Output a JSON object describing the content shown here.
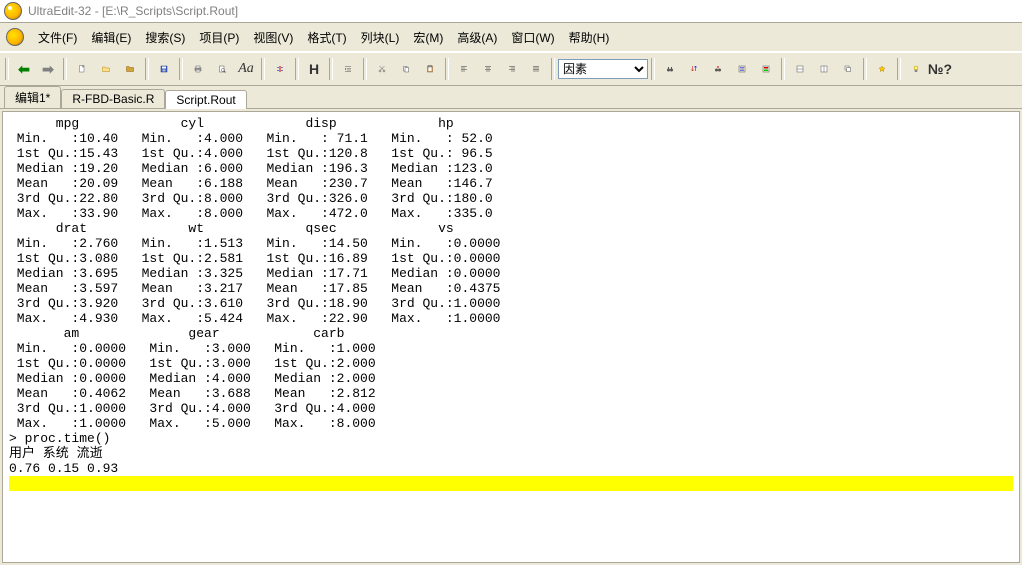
{
  "window": {
    "title": "UltraEdit-32 - [E:\\R_Scripts\\Script.Rout]"
  },
  "menus": {
    "file": "文件(F)",
    "edit": "编辑(E)",
    "search": "搜索(S)",
    "project": "项目(P)",
    "view": "视图(V)",
    "format": "格式(T)",
    "column": "列块(L)",
    "macro": "宏(M)",
    "advanced": "高级(A)",
    "window": "窗口(W)",
    "help": "帮助(H)"
  },
  "combo": {
    "value": "因素"
  },
  "tabs": [
    {
      "label": "编辑1*",
      "active": false
    },
    {
      "label": "R-FBD-Basic.R",
      "active": false
    },
    {
      "label": "Script.Rout",
      "active": true
    }
  ],
  "toolbar_buttons": {
    "back": "back",
    "forward": "forward",
    "new": "new",
    "open": "open",
    "close": "close",
    "save": "save",
    "print": "print",
    "preview": "preview",
    "font": "font",
    "toggle": "toggle",
    "heading": "heading",
    "indent": "indent",
    "cut": "cut",
    "copy": "copy",
    "paste": "paste",
    "align_left": "align-left",
    "align_center": "align-center",
    "align_right": "align-right",
    "align_justify": "align-justify",
    "find": "find",
    "sort_asc": "sort-asc",
    "sort_desc": "sort-desc",
    "tool1": "tool1",
    "tool2": "tool2",
    "split_h": "split-h",
    "split_v": "split-v",
    "cascade": "cascade",
    "tool3": "tool3",
    "tip": "tip",
    "help": "help"
  },
  "output": {
    "header1": "      mpg             cyl             disp             hp       ",
    "block1": [
      " Min.   :10.40   Min.   :4.000   Min.   : 71.1   Min.   : 52.0  ",
      " 1st Qu.:15.43   1st Qu.:4.000   1st Qu.:120.8   1st Qu.: 96.5  ",
      " Median :19.20   Median :6.000   Median :196.3   Median :123.0  ",
      " Mean   :20.09   Mean   :6.188   Mean   :230.7   Mean   :146.7  ",
      " 3rd Qu.:22.80   3rd Qu.:8.000   3rd Qu.:326.0   3rd Qu.:180.0  ",
      " Max.   :33.90   Max.   :8.000   Max.   :472.0   Max.   :335.0  "
    ],
    "header2": "      drat             wt             qsec             vs        ",
    "block2": [
      " Min.   :2.760   Min.   :1.513   Min.   :14.50   Min.   :0.0000  ",
      " 1st Qu.:3.080   1st Qu.:2.581   1st Qu.:16.89   1st Qu.:0.0000  ",
      " Median :3.695   Median :3.325   Median :17.71   Median :0.0000  ",
      " Mean   :3.597   Mean   :3.217   Mean   :17.85   Mean   :0.4375  ",
      " 3rd Qu.:3.920   3rd Qu.:3.610   3rd Qu.:18.90   3rd Qu.:1.0000  ",
      " Max.   :4.930   Max.   :5.424   Max.   :22.90   Max.   :1.0000  "
    ],
    "header3": "       am              gear            carb      ",
    "block3": [
      " Min.   :0.0000   Min.   :3.000   Min.   :1.000  ",
      " 1st Qu.:0.0000   1st Qu.:3.000   1st Qu.:2.000  ",
      " Median :0.0000   Median :4.000   Median :2.000  ",
      " Mean   :0.4062   Mean   :3.688   Mean   :2.812  ",
      " 3rd Qu.:1.0000   3rd Qu.:4.000   3rd Qu.:4.000  ",
      " Max.   :1.0000   Max.   :5.000   Max.   :8.000  "
    ],
    "proc_line": "> proc.time()",
    "proc_header": "用户 系统 流逝 ",
    "proc_values": "0.76 0.15 0.93 "
  }
}
